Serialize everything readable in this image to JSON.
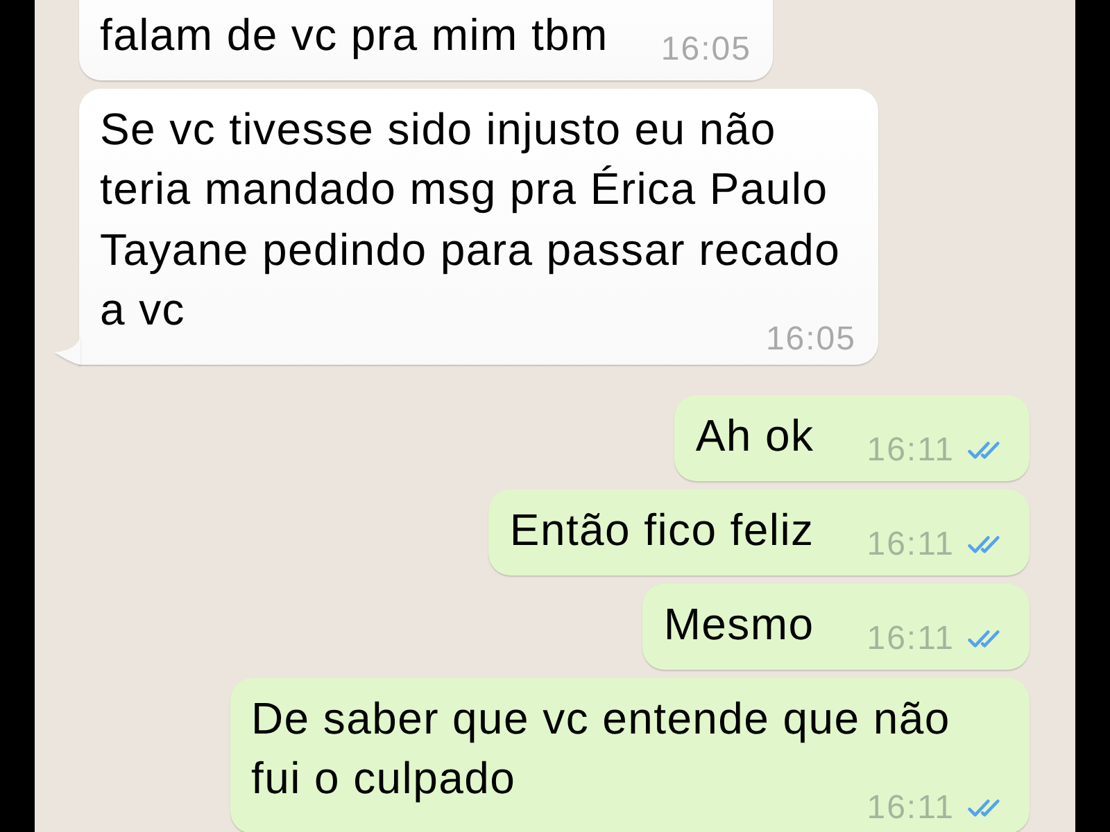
{
  "messages": [
    {
      "kind": "incoming",
      "text": "falam de vc pra mim tbm",
      "time": "16:05",
      "tail": false
    },
    {
      "kind": "incoming",
      "text": "Se vc tivesse sido injusto eu não teria mandado msg pra Érica Paulo Tayane pedindo para passar recado a vc",
      "time": "16:05",
      "tail": true
    },
    {
      "kind": "outgoing",
      "text": "Ah ok",
      "time": "16:11",
      "read": true,
      "tail": false
    },
    {
      "kind": "outgoing",
      "text": "Então fico feliz",
      "time": "16:11",
      "read": true,
      "tail": false
    },
    {
      "kind": "outgoing",
      "text": "Mesmo",
      "time": "16:11",
      "read": true,
      "tail": false
    },
    {
      "kind": "outgoing",
      "text": "De saber que vc entende que não fui o culpado",
      "time": "16:11",
      "read": true,
      "tail": false
    }
  ]
}
